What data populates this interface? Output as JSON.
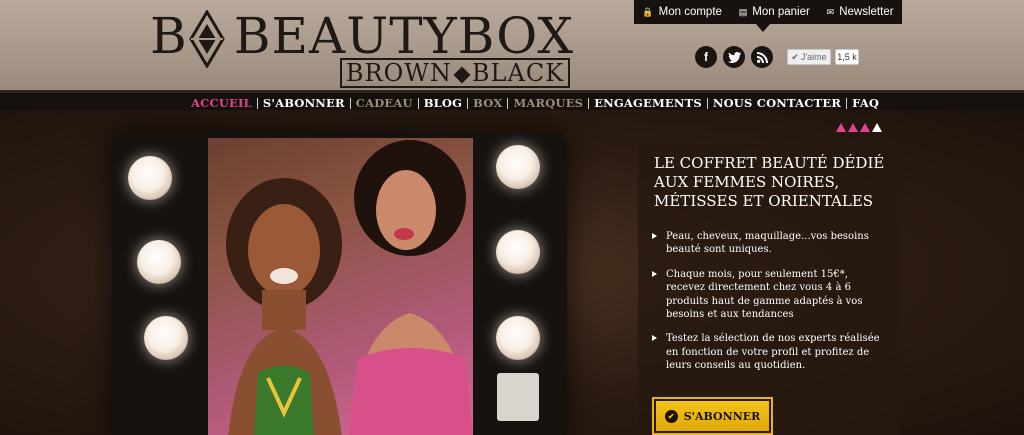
{
  "logo": {
    "main_first": "B",
    "main_rest": "BEAUTYBOX",
    "sub_left": "BROWN",
    "sub_right": "BLACK"
  },
  "topbar": {
    "items": [
      {
        "label": "Mon compte",
        "icon": "lock-icon"
      },
      {
        "label": "Mon panier",
        "icon": "basket-icon"
      },
      {
        "label": "Newsletter",
        "icon": "envelope-icon"
      }
    ]
  },
  "social": {
    "facebook": "f",
    "twitter": "t",
    "rss": "rss",
    "like_label": "J'aime",
    "like_count": "1,5 k"
  },
  "nav": {
    "items": [
      {
        "label": "ACCUEIL",
        "state": "active"
      },
      {
        "label": "S'ABONNER",
        "state": "normal"
      },
      {
        "label": "CADEAU",
        "state": "dim"
      },
      {
        "label": "BLOG",
        "state": "normal"
      },
      {
        "label": "BOX",
        "state": "dim"
      },
      {
        "label": "MARQUES",
        "state": "dim"
      },
      {
        "label": "ENGAGEMENTS",
        "state": "normal"
      },
      {
        "label": "NOUS CONTACTER",
        "state": "normal"
      },
      {
        "label": "FAQ",
        "state": "normal"
      }
    ]
  },
  "panel": {
    "title": "LE COFFRET BEAUTÉ DÉDIÉ AUX FEMMES NOIRES, MÉTISSES ET ORIENTALES",
    "bullets": [
      "Peau, cheveux, maquillage...vos besoins beauté sont uniques.",
      "Chaque mois, pour seulement 15€*, recevez directement chez vous 4 à 6 produits haut de gamme adaptés à vos besoins et aux tendances",
      "Testez la sélection de nos experts réalisée en fonction de votre profil et profitez de leurs conseils au quotidien."
    ],
    "cta": "S'ABONNER"
  },
  "colors": {
    "accent_pink": "#e0448f",
    "cta_yellow": "#f2c418",
    "nav_bg": "#15100c"
  }
}
